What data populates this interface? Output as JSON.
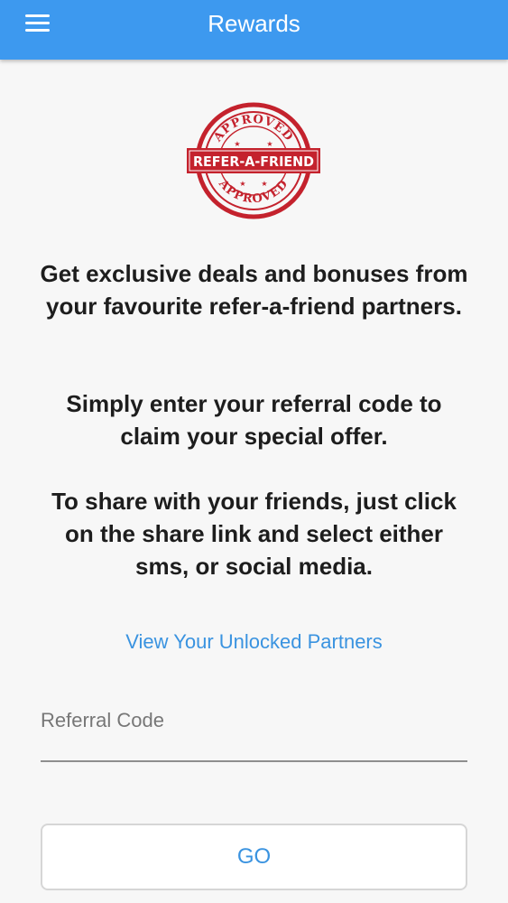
{
  "header": {
    "title": "Rewards",
    "menu_icon": "hamburger-menu-icon",
    "background": "#3d99ef"
  },
  "logo": {
    "top_text": "APPROVED",
    "center_text": "REFER-A-FRIEND",
    "bottom_text": "APPROVED",
    "color": "#c4222d"
  },
  "content": {
    "paragraph_1": "Get exclusive deals and bonuses from your favourite refer-a-friend partners.",
    "paragraph_2": "Simply enter your referral code to claim your special offer.",
    "paragraph_3": "To share with your friends, just click on the share link and select either sms, or social media.",
    "partners_link": "View Your Unlocked Partners"
  },
  "referral": {
    "placeholder": "Referral Code",
    "value": ""
  },
  "go_button": {
    "label": "GO"
  },
  "colors": {
    "accent": "#3a93e0",
    "background": "#f7f7f7",
    "text": "#1d1d1d"
  }
}
